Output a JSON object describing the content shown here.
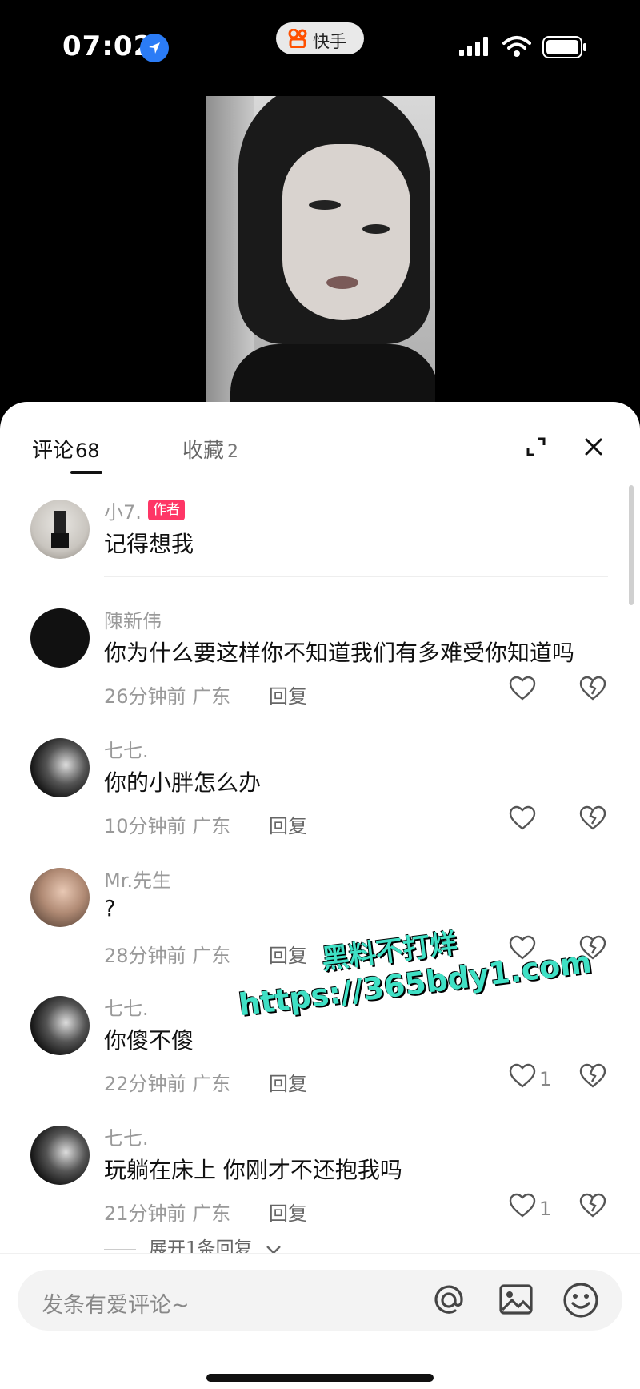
{
  "status_bar": {
    "time": "07:02",
    "app_name": "快手"
  },
  "tabs": {
    "comments_label": "评论",
    "comments_count": "68",
    "favorites_label": "收藏",
    "favorites_count": "2"
  },
  "comments": [
    {
      "username": "小7.",
      "badge": "作者",
      "text": "记得想我",
      "time": "",
      "region": "",
      "reply": "",
      "likes": ""
    },
    {
      "username": "陳新伟",
      "text": "你为什么要这样你不知道我们有多难受你知道吗",
      "time": "26分钟前",
      "region": "广东",
      "reply": "回复",
      "likes": ""
    },
    {
      "username": "七七.",
      "text": "你的小胖怎么办",
      "time": "10分钟前",
      "region": "广东",
      "reply": "回复",
      "likes": ""
    },
    {
      "username": "Mr.先生",
      "text": "?",
      "time": "28分钟前",
      "region": "广东",
      "reply": "回复",
      "likes": ""
    },
    {
      "username": "七七.",
      "text": "你傻不傻",
      "time": "22分钟前",
      "region": "广东",
      "reply": "回复",
      "likes": "1"
    },
    {
      "username": "七七.",
      "text": "玩躺在床上 你刚才不还抱我吗",
      "time": "21分钟前",
      "region": "广东",
      "reply": "回复",
      "likes": "1"
    }
  ],
  "expand_replies": "展开1条回复",
  "input": {
    "placeholder": "发条有爱评论~"
  },
  "watermark": {
    "line1": "黑料不打烊",
    "line2": "https://365bdy1.com"
  },
  "icons": [
    "location-arrow-icon",
    "kuaishou-logo-icon",
    "signal-icon",
    "wifi-icon",
    "battery-icon",
    "expand-icon",
    "close-icon",
    "heart-icon",
    "broken-heart-icon",
    "at-icon",
    "image-icon",
    "emoji-icon"
  ],
  "colors": {
    "author_badge": "#fe3666",
    "location_blue": "#2b7cf6",
    "watermark": "#3fe0c5"
  }
}
